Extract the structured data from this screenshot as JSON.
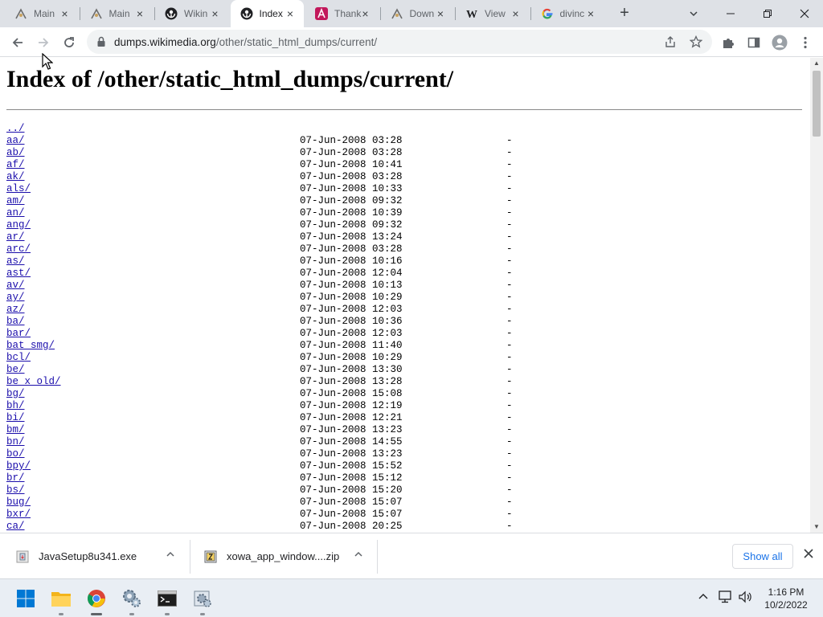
{
  "browser": {
    "tabs": [
      {
        "title": "Main",
        "favicon": "mediawiki-icon",
        "active": false
      },
      {
        "title": "Main",
        "favicon": "mediawiki-icon",
        "active": false
      },
      {
        "title": "Wikin",
        "favicon": "wikimedia-icon",
        "active": false
      },
      {
        "title": "Index",
        "favicon": "wikimedia-icon",
        "active": true
      },
      {
        "title": "Thank",
        "favicon": "a-logo-icon",
        "active": false
      },
      {
        "title": "Down",
        "favicon": "mediawiki-icon",
        "active": false
      },
      {
        "title": "View",
        "favicon": "wikipedia-w-icon",
        "active": false
      },
      {
        "title": "divinc",
        "favicon": "google-icon",
        "active": false
      }
    ],
    "url_host": "dumps.wikimedia.org",
    "url_path": "/other/static_html_dumps/current/"
  },
  "page": {
    "heading": "Index of /other/static_html_dumps/current/",
    "parent_link": "../",
    "entries": [
      {
        "name": "aa/",
        "date": "07-Jun-2008 03:28",
        "size": "-"
      },
      {
        "name": "ab/",
        "date": "07-Jun-2008 03:28",
        "size": "-"
      },
      {
        "name": "af/",
        "date": "07-Jun-2008 10:41",
        "size": "-"
      },
      {
        "name": "ak/",
        "date": "07-Jun-2008 03:28",
        "size": "-"
      },
      {
        "name": "als/",
        "date": "07-Jun-2008 10:33",
        "size": "-"
      },
      {
        "name": "am/",
        "date": "07-Jun-2008 09:32",
        "size": "-"
      },
      {
        "name": "an/",
        "date": "07-Jun-2008 10:39",
        "size": "-"
      },
      {
        "name": "ang/",
        "date": "07-Jun-2008 09:32",
        "size": "-"
      },
      {
        "name": "ar/",
        "date": "07-Jun-2008 13:24",
        "size": "-"
      },
      {
        "name": "arc/",
        "date": "07-Jun-2008 03:28",
        "size": "-"
      },
      {
        "name": "as/",
        "date": "07-Jun-2008 10:16",
        "size": "-"
      },
      {
        "name": "ast/",
        "date": "07-Jun-2008 12:04",
        "size": "-"
      },
      {
        "name": "av/",
        "date": "07-Jun-2008 10:13",
        "size": "-"
      },
      {
        "name": "ay/",
        "date": "07-Jun-2008 10:29",
        "size": "-"
      },
      {
        "name": "az/",
        "date": "07-Jun-2008 12:03",
        "size": "-"
      },
      {
        "name": "ba/",
        "date": "07-Jun-2008 10:36",
        "size": "-"
      },
      {
        "name": "bar/",
        "date": "07-Jun-2008 12:03",
        "size": "-"
      },
      {
        "name": "bat_smg/",
        "date": "07-Jun-2008 11:40",
        "size": "-"
      },
      {
        "name": "bcl/",
        "date": "07-Jun-2008 10:29",
        "size": "-"
      },
      {
        "name": "be/",
        "date": "07-Jun-2008 13:30",
        "size": "-"
      },
      {
        "name": "be_x_old/",
        "date": "07-Jun-2008 13:28",
        "size": "-"
      },
      {
        "name": "bg/",
        "date": "07-Jun-2008 15:08",
        "size": "-"
      },
      {
        "name": "bh/",
        "date": "07-Jun-2008 12:19",
        "size": "-"
      },
      {
        "name": "bi/",
        "date": "07-Jun-2008 12:21",
        "size": "-"
      },
      {
        "name": "bm/",
        "date": "07-Jun-2008 13:23",
        "size": "-"
      },
      {
        "name": "bn/",
        "date": "07-Jun-2008 14:55",
        "size": "-"
      },
      {
        "name": "bo/",
        "date": "07-Jun-2008 13:23",
        "size": "-"
      },
      {
        "name": "bpy/",
        "date": "07-Jun-2008 15:52",
        "size": "-"
      },
      {
        "name": "br/",
        "date": "07-Jun-2008 15:12",
        "size": "-"
      },
      {
        "name": "bs/",
        "date": "07-Jun-2008 15:20",
        "size": "-"
      },
      {
        "name": "bug/",
        "date": "07-Jun-2008 15:07",
        "size": "-"
      },
      {
        "name": "bxr/",
        "date": "07-Jun-2008 15:07",
        "size": "-"
      },
      {
        "name": "ca/",
        "date": "07-Jun-2008 20:25",
        "size": "-"
      }
    ]
  },
  "downloads": {
    "items": [
      {
        "name": "JavaSetup8u341.exe",
        "icon": "installer-icon"
      },
      {
        "name": "xowa_app_window....zip",
        "icon": "zip-archive-icon"
      }
    ],
    "show_all_label": "Show all"
  },
  "taskbar": {
    "time": "1:16 PM",
    "date": "10/2/2022"
  },
  "colors": {
    "tabstrip_bg": "#dee1e6",
    "link": "#1a0dab",
    "accent": "#1a73e8",
    "taskbar_bg": "#e9eef4"
  }
}
